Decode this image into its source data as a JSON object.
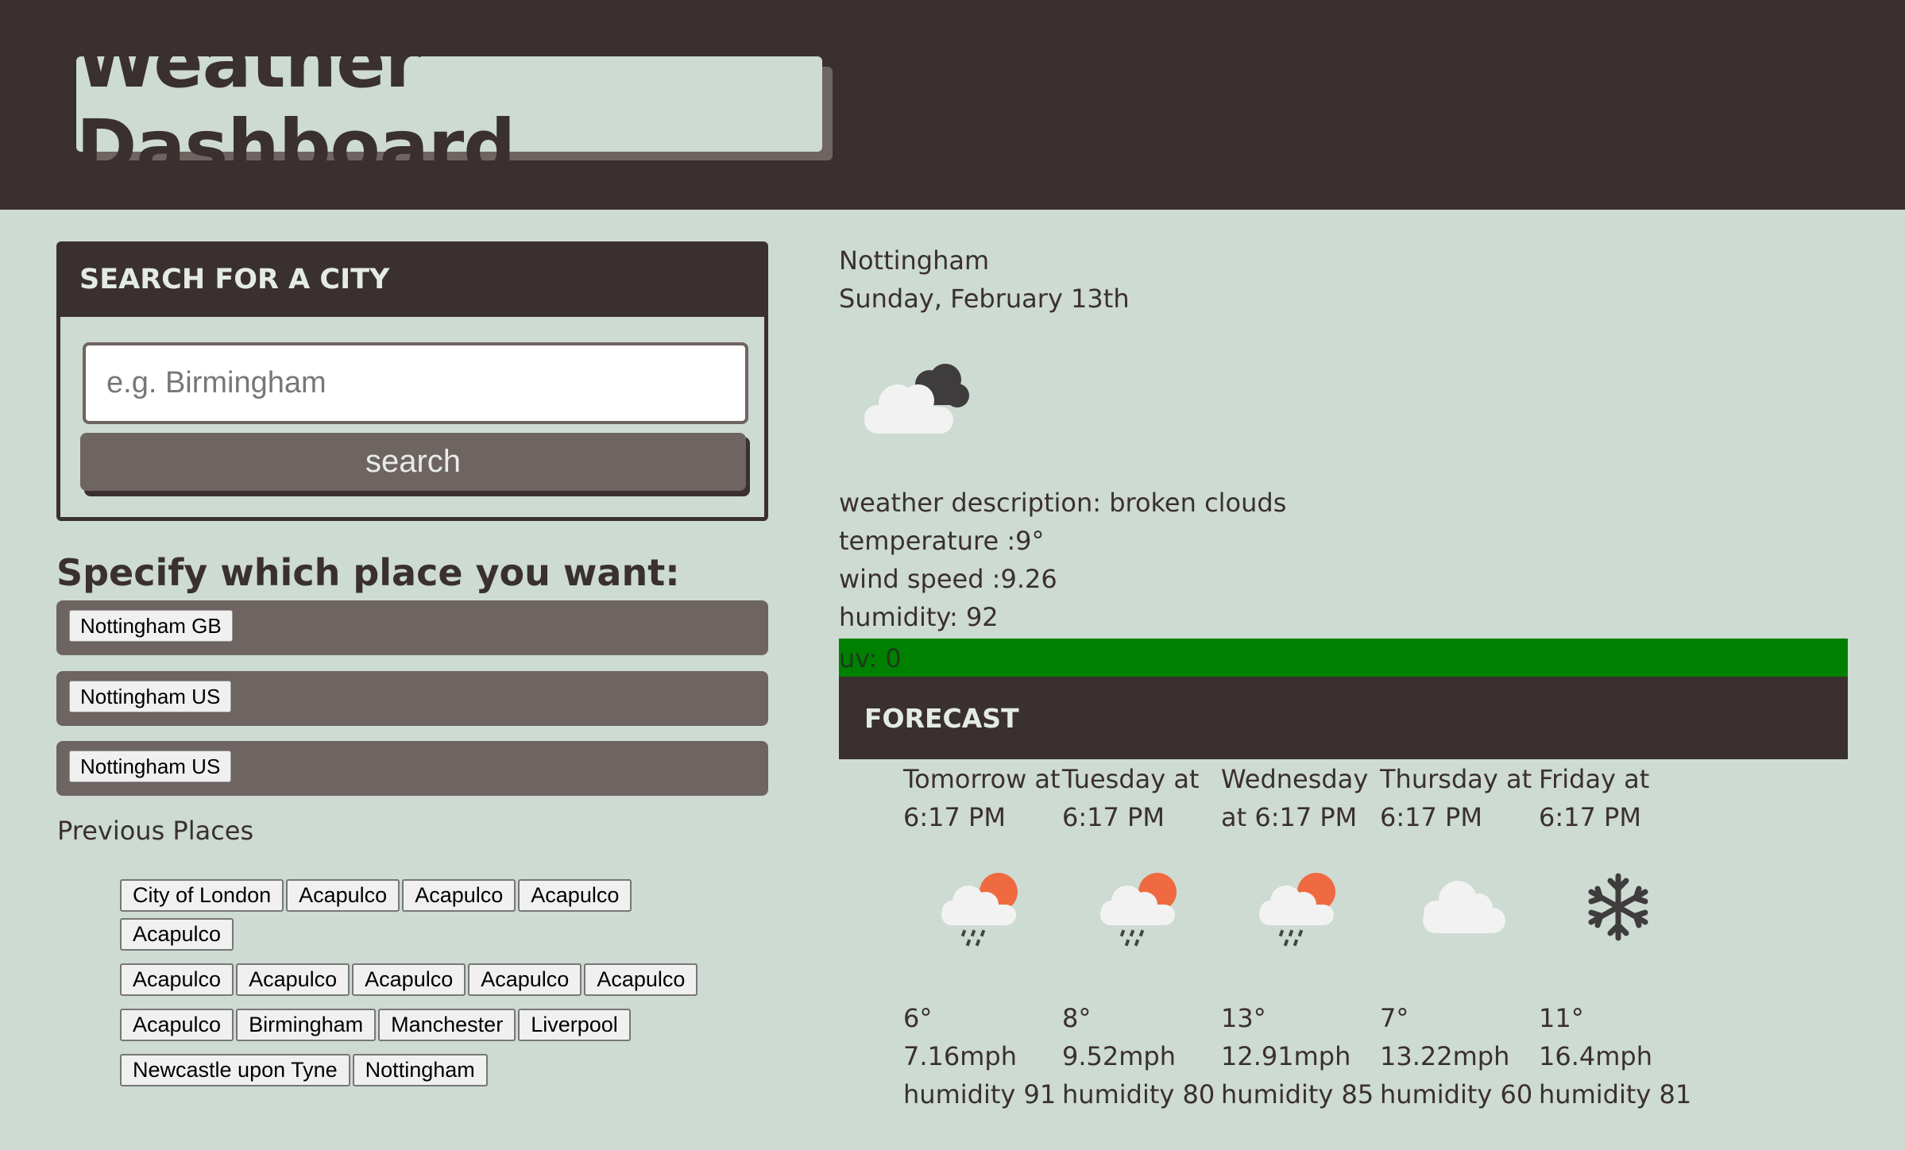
{
  "header": {
    "title": "Weather Dashboard"
  },
  "search": {
    "heading": "SEARCH FOR A CITY",
    "placeholder": "e.g. Birmingham",
    "button_label": "search"
  },
  "specify": {
    "title": "Specify which place you want:",
    "options": [
      "Nottingham GB",
      "Nottingham US",
      "Nottingham US"
    ]
  },
  "previous": {
    "title": "Previous Places",
    "places": [
      "City of London",
      "Acapulco",
      "Acapulco",
      "Acapulco",
      "Acapulco",
      "Acapulco",
      "Acapulco",
      "Acapulco",
      "Acapulco",
      "Acapulco",
      "Acapulco",
      "Birmingham",
      "Manchester",
      "Liverpool",
      "Newcastle upon Tyne",
      "Nottingham"
    ]
  },
  "current": {
    "city": "Nottingham",
    "date": "Sunday, February 13th",
    "icon": "broken-clouds-icon",
    "description": "weather description: broken clouds",
    "temperature": "temperature :9°",
    "wind": "wind speed :9.26",
    "humidity": "humidity: 92",
    "uv": "uv: 0",
    "uv_color": "#008000"
  },
  "forecast": {
    "heading": "FORECAST",
    "days": [
      {
        "date": "Tomorrow at 6:17 PM",
        "icon": "rain-sun-icon",
        "temp": "6°",
        "wind": "7.16mph",
        "humidity": "humidity 91"
      },
      {
        "date": "Tuesday at 6:17 PM",
        "icon": "rain-sun-icon",
        "temp": "8°",
        "wind": "9.52mph",
        "humidity": "humidity 80"
      },
      {
        "date": "Wednesday at 6:17 PM",
        "icon": "rain-sun-icon",
        "temp": "13°",
        "wind": "12.91mph",
        "humidity": "humidity 85"
      },
      {
        "date": "Thursday at 6:17 PM",
        "icon": "cloud-icon",
        "temp": "7°",
        "wind": "13.22mph",
        "humidity": "humidity 60"
      },
      {
        "date": "Friday at 6:17 PM",
        "icon": "snowflake-icon",
        "temp": "11°",
        "wind": "16.4mph",
        "humidity": "humidity 81"
      }
    ]
  },
  "colors": {
    "background": "#cddbd2",
    "dark": "#3a302f",
    "muted": "#6e6461",
    "uv_green": "#008000"
  }
}
